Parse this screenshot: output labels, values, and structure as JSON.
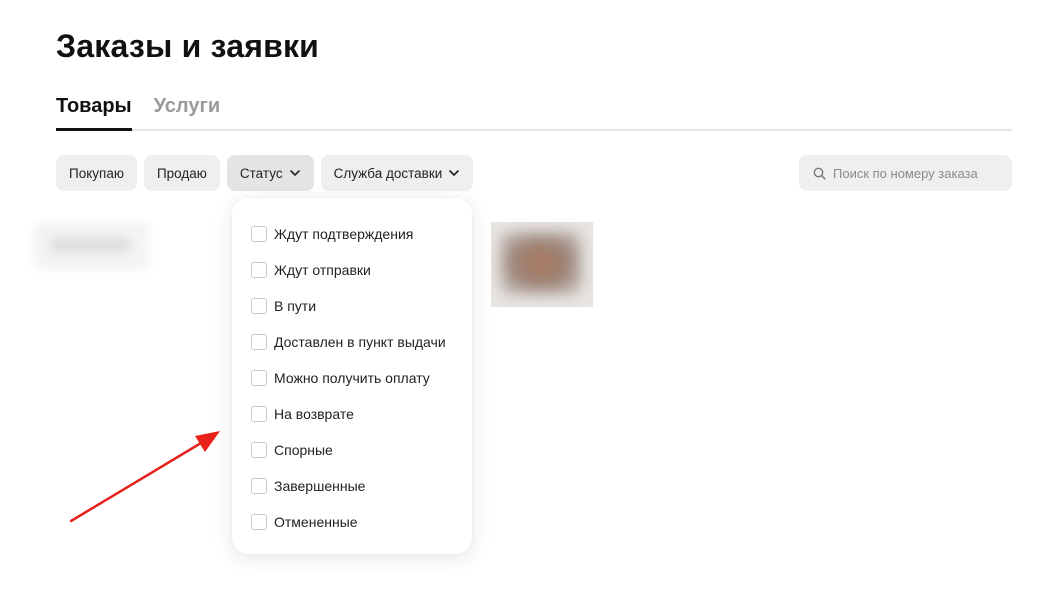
{
  "page": {
    "title": "Заказы и заявки"
  },
  "tabs": [
    {
      "label": "Товары",
      "active": true
    },
    {
      "label": "Услуги",
      "active": false
    }
  ],
  "filters": {
    "buying_label": "Покупаю",
    "selling_label": "Продаю",
    "status_label": "Статус",
    "delivery_label": "Служба доставки"
  },
  "search": {
    "placeholder": "Поиск по номеру заказа",
    "value": "",
    "icon": "search-icon"
  },
  "status_dropdown": {
    "options": [
      {
        "label": "Ждут подтверждения",
        "checked": false
      },
      {
        "label": "Ждут отправки",
        "checked": false
      },
      {
        "label": "В пути",
        "checked": false
      },
      {
        "label": "Доставлен в пункт выдачи",
        "checked": false
      },
      {
        "label": "Можно получить оплату",
        "checked": false
      },
      {
        "label": "На возврате",
        "checked": false
      },
      {
        "label": "Спорные",
        "checked": false
      },
      {
        "label": "Завершенные",
        "checked": false
      },
      {
        "label": "Отмененные",
        "checked": false
      }
    ]
  },
  "annotation": {
    "arrow_color": "#e8221b"
  },
  "colors": {
    "chip_bg": "#efefef",
    "text": "#111111",
    "inactive_tab": "#9a9a9a"
  }
}
